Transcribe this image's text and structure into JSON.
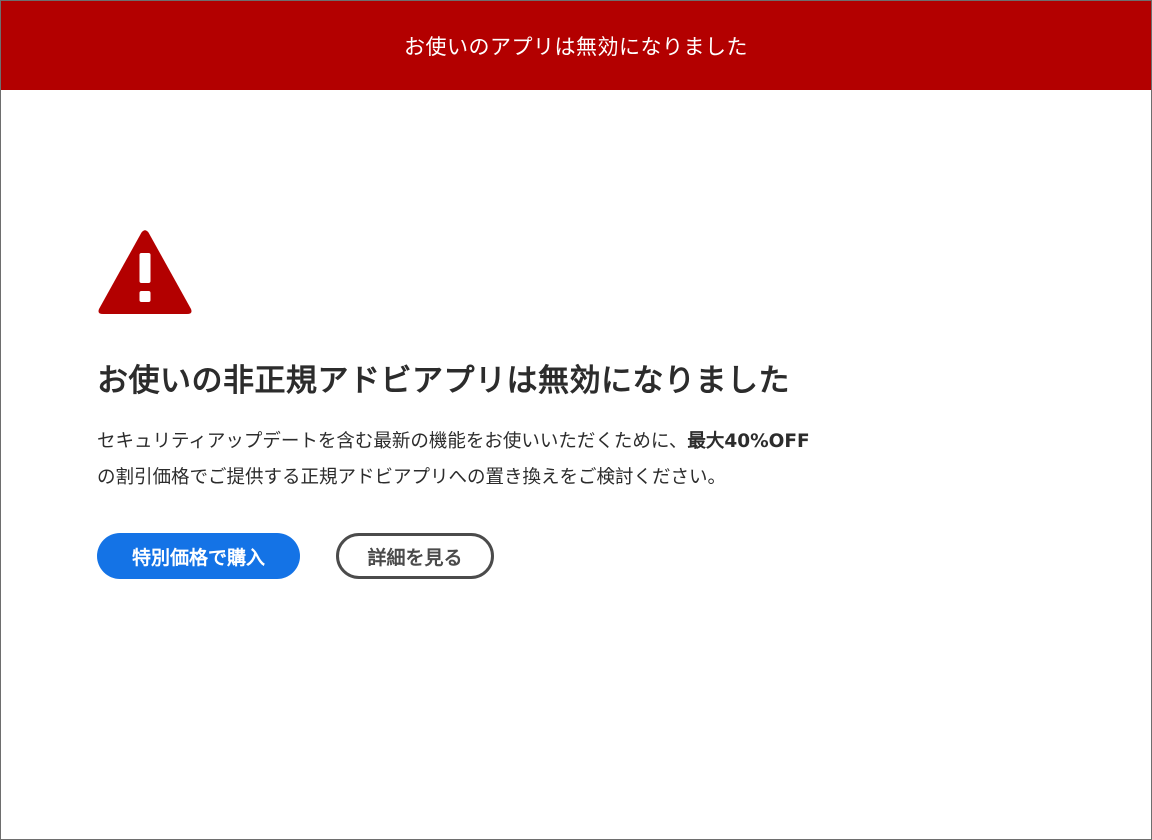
{
  "banner": {
    "text": "お使いのアプリは無効になりました"
  },
  "alert": {
    "icon": "warning-triangle-icon",
    "icon_color": "#b30000",
    "title": "お使いの非正規アドビアプリは無効になりました",
    "description_part1": "セキュリティアップデートを含む最新の機能をお使いいただくために、",
    "description_emphasis": "最大40%OFF",
    "description_part2": "の割引価格でご提供する正規アドビアプリへの置き換えをご検討ください。"
  },
  "actions": {
    "buy_label": "特別価格で購入",
    "details_label": "詳細を見る"
  },
  "colors": {
    "banner_bg": "#b30000",
    "primary_button": "#1473e6",
    "secondary_button_border": "#4b4b4b",
    "text": "#2c2c2c"
  }
}
